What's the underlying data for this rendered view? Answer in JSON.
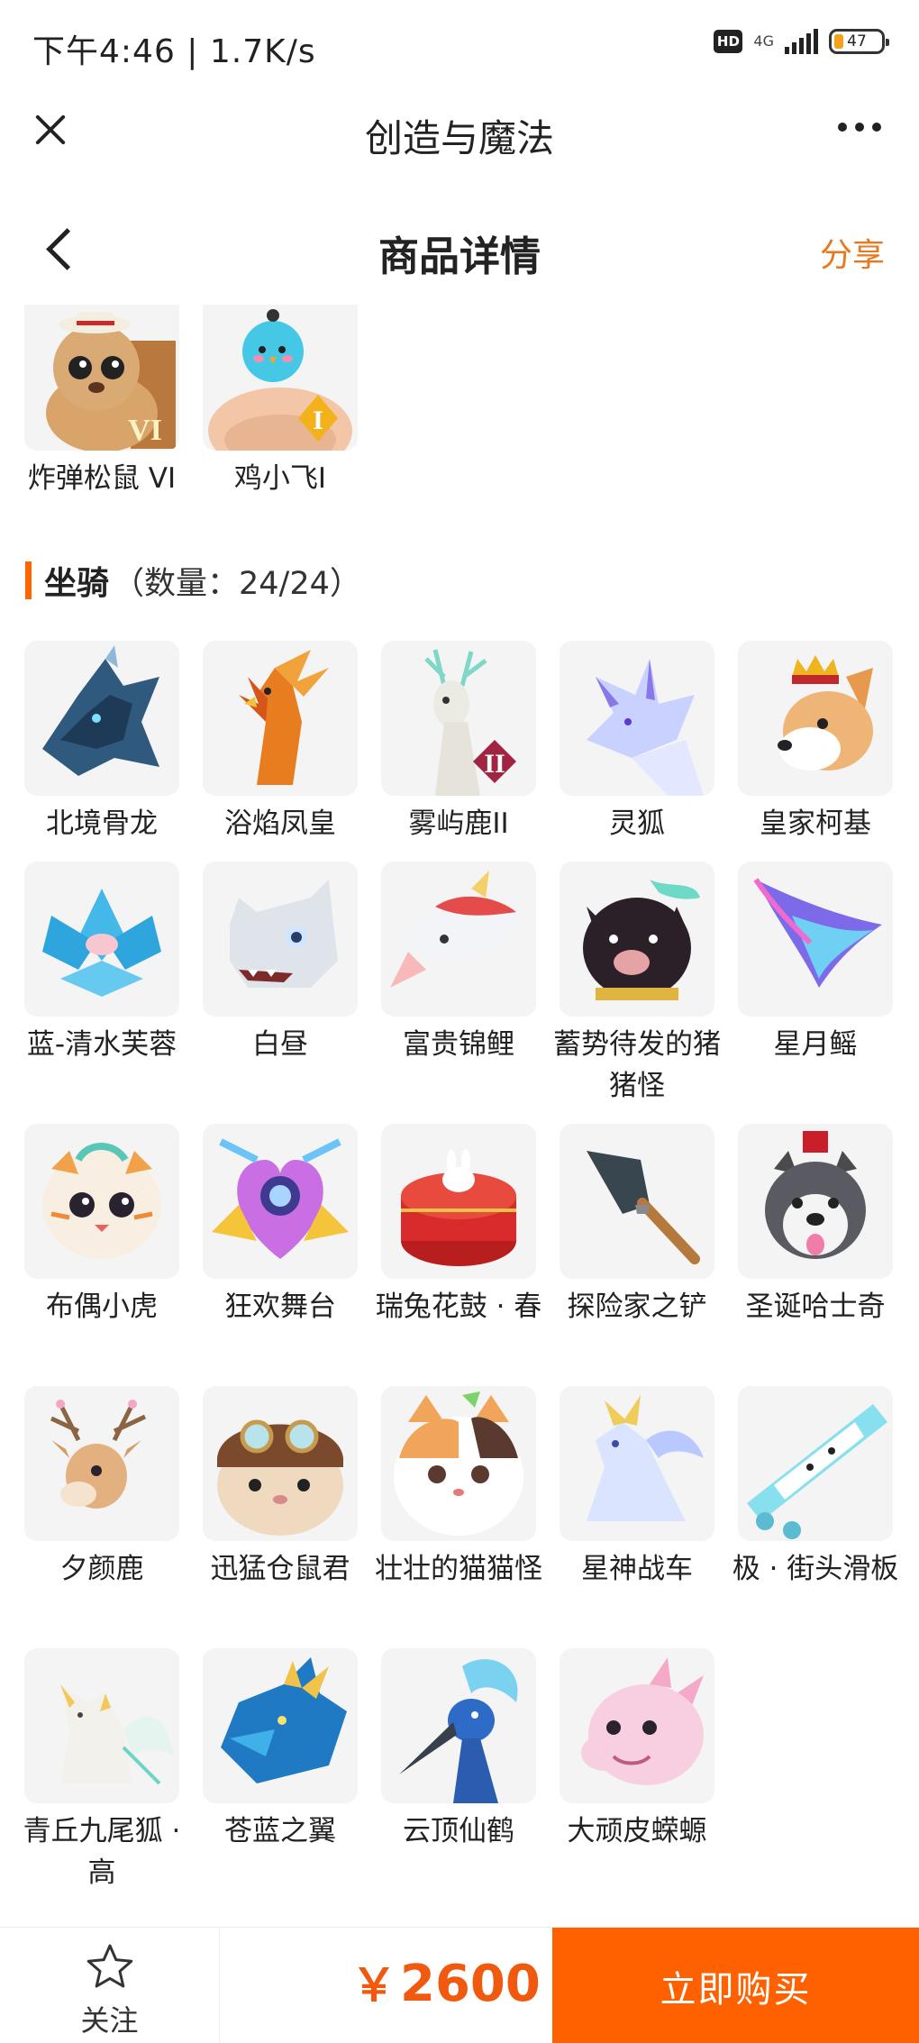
{
  "status_bar": {
    "time": "下午4:46 | 1.7K/s",
    "hd": "HD",
    "network": "4G",
    "battery": "47"
  },
  "app_header": {
    "title": "创造与魔法"
  },
  "page_header": {
    "title": "商品详情",
    "share_label": "分享"
  },
  "prev_section_items": [
    {
      "name": "炸弹松鼠 VI",
      "icon": "bomb-squirrel-icon",
      "badge": "VI"
    },
    {
      "name": "鸡小飞I",
      "icon": "chicken-icon",
      "badge": "I"
    }
  ],
  "mounts_section": {
    "title": "坐骑",
    "count": "（数量：24/24）",
    "items": [
      {
        "name": "北境骨龙",
        "icon": "bone-dragon-icon"
      },
      {
        "name": "浴焰凤皇",
        "icon": "phoenix-icon"
      },
      {
        "name": "雾屿鹿II",
        "icon": "mist-deer-icon",
        "badge": "II"
      },
      {
        "name": "灵狐",
        "icon": "spirit-fox-icon"
      },
      {
        "name": "皇家柯基",
        "icon": "royal-corgi-icon"
      },
      {
        "name": "蓝-清水芙蓉",
        "icon": "blue-lotus-icon"
      },
      {
        "name": "白昼",
        "icon": "white-dragon-icon"
      },
      {
        "name": "富贵锦鲤",
        "icon": "koi-icon"
      },
      {
        "name": "蓄势待发的猪猪怪",
        "icon": "black-pig-icon"
      },
      {
        "name": "星月鳐",
        "icon": "star-ray-icon"
      },
      {
        "name": "布偶小虎",
        "icon": "doll-tiger-icon"
      },
      {
        "name": "狂欢舞台",
        "icon": "carnival-stage-icon"
      },
      {
        "name": "瑞兔花鼓 · 春",
        "icon": "rabbit-drum-icon"
      },
      {
        "name": "探险家之铲",
        "icon": "shovel-icon"
      },
      {
        "name": "圣诞哈士奇",
        "icon": "husky-icon"
      },
      {
        "name": "夕颜鹿",
        "icon": "blossom-deer-icon"
      },
      {
        "name": "迅猛仓鼠君",
        "icon": "hamster-icon"
      },
      {
        "name": "壮壮的猫猫怪",
        "icon": "fat-cat-icon"
      },
      {
        "name": "星神战车",
        "icon": "star-horse-icon"
      },
      {
        "name": "极 · 街头滑板",
        "icon": "skateboard-icon"
      },
      {
        "name": "青丘九尾狐 · 高",
        "icon": "nine-tail-fox-icon"
      },
      {
        "name": "苍蓝之翼",
        "icon": "azure-wing-icon"
      },
      {
        "name": "云顶仙鹤",
        "icon": "crane-icon"
      },
      {
        "name": "大顽皮蝾螈",
        "icon": "axolotl-icon"
      }
    ]
  },
  "bottom_bar": {
    "follow_label": "关注",
    "price_symbol": "￥",
    "price_value": "2600",
    "buy_label": "立即购买"
  },
  "colors": {
    "accent": "#ff6100",
    "price": "#f05a0f",
    "share": "#e8781e",
    "tile_bg": "#f4f4f5"
  }
}
